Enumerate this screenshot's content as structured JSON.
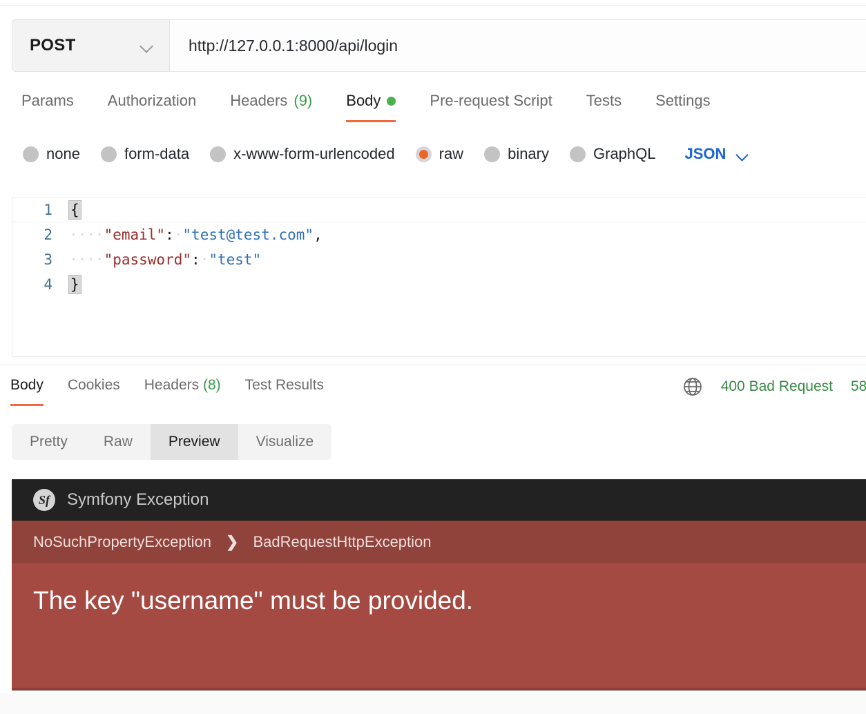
{
  "request": {
    "method": "POST",
    "method_icon": "chevron-down-icon",
    "url": "http://127.0.0.1:8000/api/login",
    "tabs": [
      {
        "label": "Params",
        "active": false,
        "count": "",
        "dot": false
      },
      {
        "label": "Authorization",
        "active": false,
        "count": "",
        "dot": false
      },
      {
        "label": "Headers",
        "active": false,
        "count": "(9)",
        "dot": false
      },
      {
        "label": "Body",
        "active": true,
        "count": "",
        "dot": true
      },
      {
        "label": "Pre-request Script",
        "active": false,
        "count": "",
        "dot": false
      },
      {
        "label": "Tests",
        "active": false,
        "count": "",
        "dot": false
      },
      {
        "label": "Settings",
        "active": false,
        "count": "",
        "dot": false
      }
    ],
    "body_types": [
      {
        "label": "none",
        "selected": false
      },
      {
        "label": "form-data",
        "selected": false
      },
      {
        "label": "x-www-form-urlencoded",
        "selected": false
      },
      {
        "label": "raw",
        "selected": true
      },
      {
        "label": "binary",
        "selected": false
      },
      {
        "label": "GraphQL",
        "selected": false
      }
    ],
    "raw_format": "JSON",
    "raw_format_icon": "chevron-down-icon",
    "editor": {
      "lines": [
        {
          "num": "1",
          "open_brace": "{",
          "indent": "",
          "key": "",
          "colon": "",
          "value": "",
          "comma": "",
          "close_brace": ""
        },
        {
          "num": "2",
          "open_brace": "",
          "indent": "····",
          "key": "\"email\"",
          "colon": ":",
          "space": "·",
          "value": "\"test@test.com\"",
          "comma": ",",
          "close_brace": ""
        },
        {
          "num": "3",
          "open_brace": "",
          "indent": "····",
          "key": "\"password\"",
          "colon": ":",
          "space": "·",
          "value": "\"test\"",
          "comma": "",
          "close_brace": ""
        },
        {
          "num": "4",
          "open_brace": "",
          "indent": "",
          "key": "",
          "colon": "",
          "value": "",
          "comma": "",
          "close_brace": "}"
        }
      ]
    }
  },
  "response": {
    "tabs": [
      {
        "label": "Body",
        "active": true,
        "count": ""
      },
      {
        "label": "Cookies",
        "active": false,
        "count": ""
      },
      {
        "label": "Headers",
        "active": false,
        "count": "(8)"
      },
      {
        "label": "Test Results",
        "active": false,
        "count": ""
      }
    ],
    "status_icon": "globe-icon",
    "status": "400 Bad Request",
    "size": "58",
    "views": [
      {
        "label": "Pretty",
        "active": false
      },
      {
        "label": "Raw",
        "active": false
      },
      {
        "label": "Preview",
        "active": true
      },
      {
        "label": "Visualize",
        "active": false
      }
    ]
  },
  "exception": {
    "logo_icon": "symfony-logo-icon",
    "logo_text": "Sf",
    "title": "Symfony Exception",
    "breadcrumb": [
      "NoSuchPropertyException",
      "BadRequestHttpException"
    ],
    "breadcrumb_separator": "❯",
    "message": "The key \"username\" must be provided."
  },
  "colors": {
    "accent_orange": "#ef6a3d",
    "status_green": "#3a8a46",
    "json_blue": "#1c63d5",
    "exception_dark": "#222222",
    "exception_crumb_red": "#8f433b",
    "exception_body_red": "#a44a42",
    "raw_radio_orange": "#eb6528"
  }
}
